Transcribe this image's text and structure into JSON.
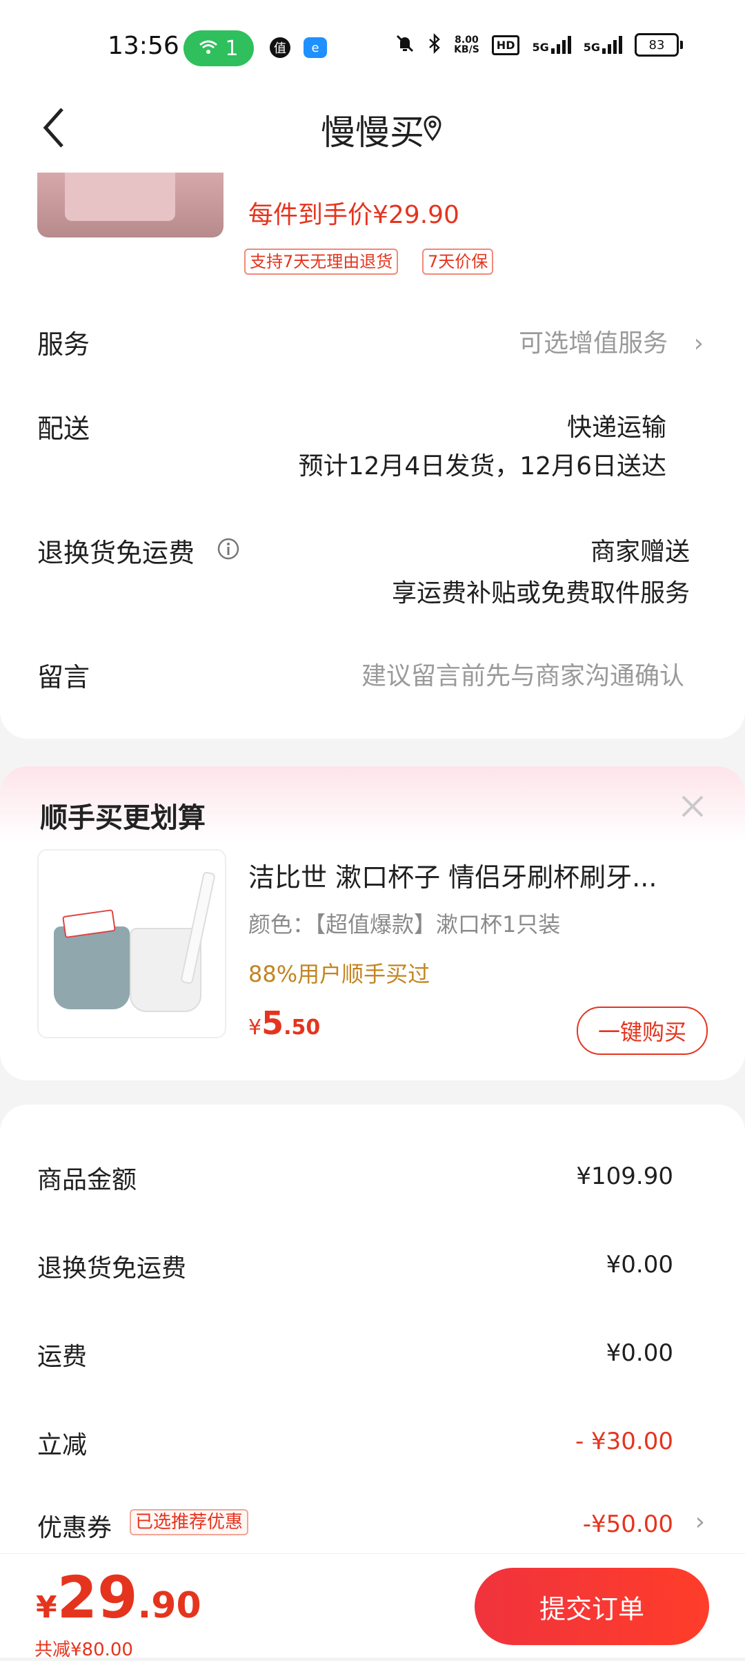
{
  "status_bar": {
    "time": "13:56",
    "wifi_count": "1",
    "app_icon_1": "值",
    "app_icon_2": "e",
    "net_speed_value": "8.00",
    "net_speed_unit": "KB/S",
    "hd_label": "HD",
    "signal_1": "5G",
    "signal_2": "5G",
    "battery": "83"
  },
  "header": {
    "title": "慢慢买",
    "back_icon": "chevron-left-icon",
    "location_icon": "location-pin-icon"
  },
  "product": {
    "price_label": "每件到手价¥29.90",
    "badges": [
      "支持7天无理由退货",
      "7天价保"
    ]
  },
  "rows": {
    "service_label": "服务",
    "service_value": "可选增值服务",
    "delivery_label": "配送",
    "delivery_method": "快递运输",
    "delivery_eta": "预计12月4日发货，12月6日送达",
    "return_label": "退换货免运费",
    "return_value": "商家赠送",
    "return_desc": "享运费补贴或免费取件服务",
    "message_label": "留言",
    "message_placeholder": "建议留言前先与商家沟通确认"
  },
  "addon": {
    "title": "顺手买更划算",
    "product_name": "洁比世 漱口杯子 情侣牙刷杯刷牙...",
    "spec": "颜色：【超值爆款】漱口杯1只装",
    "stat": "88%用户顺手买过",
    "price_symbol": "¥",
    "price_int": "5",
    "price_dec": ".50",
    "button": "一键购买"
  },
  "summary": {
    "rows": [
      {
        "label": "商品金额",
        "value": "¥109.90"
      },
      {
        "label": "退换货免运费",
        "value": "¥0.00"
      },
      {
        "label": "运费",
        "value": "¥0.00"
      },
      {
        "label": "立减",
        "value": "- ¥30.00"
      },
      {
        "label": "优惠券",
        "value": "-¥50.00"
      }
    ],
    "coupon_badge": "已选推荐优惠"
  },
  "bottom": {
    "price_symbol": "¥",
    "price_int": "29",
    "price_dec": ".90",
    "total_saved": "共减¥80.00",
    "submit": "提交订单"
  },
  "colors": {
    "accent_red": "#e5341e",
    "wifi_green": "#2fbf5c",
    "stat_orange": "#c38422"
  }
}
